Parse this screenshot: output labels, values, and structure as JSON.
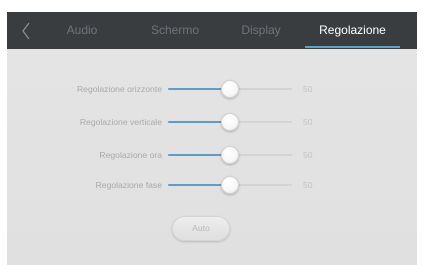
{
  "tabs": [
    {
      "label": "Audio",
      "active": false
    },
    {
      "label": "Schermo",
      "active": false
    },
    {
      "label": "Display",
      "active": false
    },
    {
      "label": "Regolazione",
      "active": true
    }
  ],
  "sliders": [
    {
      "label": "Regolazione orizzonte",
      "value": "50",
      "level": 0.5
    },
    {
      "label": "Regolazione verticale",
      "value": "50",
      "level": 0.5
    },
    {
      "label": "Regolazione ora",
      "value": "50",
      "level": 0.5
    },
    {
      "label": "Regolazione fase",
      "value": "50",
      "level": 0.5
    }
  ],
  "auto_button": {
    "label": "Auto"
  },
  "colors": {
    "tabbar_bg": "#3a3d40",
    "accent": "#5fa3c6",
    "panel_bg": "#e3e3e3"
  },
  "icons": {
    "back": "chevron-left-icon"
  }
}
